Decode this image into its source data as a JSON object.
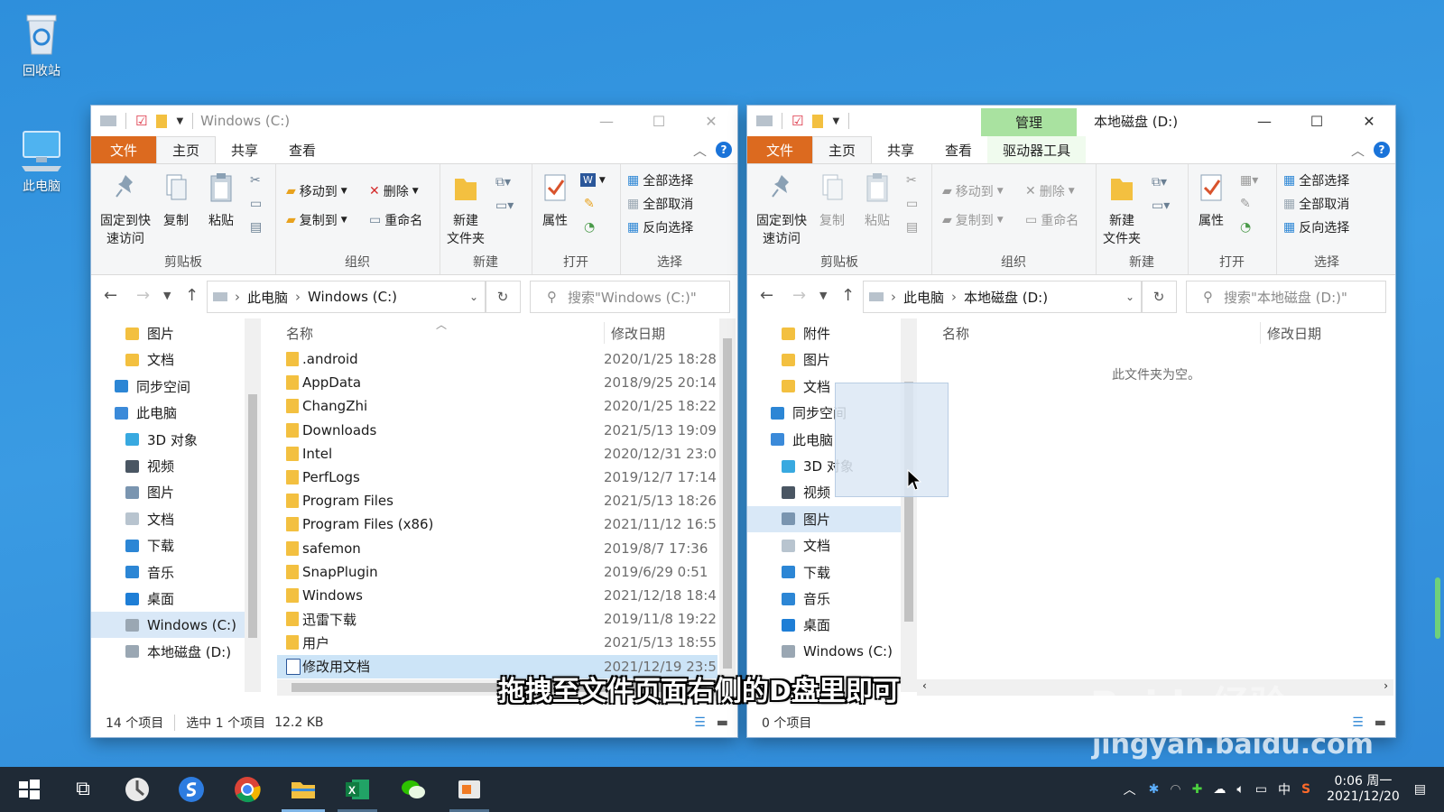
{
  "desktop": {
    "icons": [
      {
        "label": "回收站",
        "icon": "recycle-bin-icon"
      },
      {
        "label": "此电脑",
        "icon": "computer-icon"
      }
    ]
  },
  "left_window": {
    "title": "Windows (C:)",
    "tabs": [
      "文件",
      "主页",
      "共享",
      "查看"
    ],
    "active_tab": "主页",
    "ribbon": {
      "clipboard": {
        "label": "剪贴板",
        "pin": "固定到快\n速访问",
        "copy": "复制",
        "paste": "粘贴"
      },
      "organize": {
        "label": "组织",
        "move_to": "移动到",
        "copy_to": "复制到",
        "delete": "删除",
        "rename": "重命名"
      },
      "new": {
        "label": "新建",
        "new_folder": "新建\n文件夹"
      },
      "open": {
        "label": "打开",
        "properties": "属性"
      },
      "select": {
        "label": "选择",
        "select_all": "全部选择",
        "select_none": "全部取消",
        "invert": "反向选择"
      }
    },
    "address": {
      "crumbs": [
        "此电脑",
        "Windows (C:)"
      ],
      "search_placeholder": "搜索\"Windows (C:)\""
    },
    "nav_items": [
      {
        "label": "图片",
        "icon": "folder-icon",
        "indent": 1
      },
      {
        "label": "文档",
        "icon": "folder-icon",
        "indent": 1
      },
      {
        "label": "同步空间",
        "icon": "sync-space-icon",
        "indent": 0
      },
      {
        "label": "此电脑",
        "icon": "computer-icon",
        "indent": 0
      },
      {
        "label": "3D 对象",
        "icon": "3d-objects-icon",
        "indent": 1
      },
      {
        "label": "视频",
        "icon": "video-icon",
        "indent": 1
      },
      {
        "label": "图片",
        "icon": "pictures-icon",
        "indent": 1
      },
      {
        "label": "文档",
        "icon": "documents-icon",
        "indent": 1
      },
      {
        "label": "下载",
        "icon": "download-icon",
        "indent": 1
      },
      {
        "label": "音乐",
        "icon": "music-icon",
        "indent": 1
      },
      {
        "label": "桌面",
        "icon": "desktop-icon",
        "indent": 1
      },
      {
        "label": "Windows (C:)",
        "icon": "drive-c-icon",
        "indent": 1,
        "selected": true
      },
      {
        "label": "本地磁盘 (D:)",
        "icon": "drive-d-icon",
        "indent": 1
      }
    ],
    "columns": {
      "name": "名称",
      "date": "修改日期"
    },
    "files": [
      {
        "name": ".android",
        "date": "2020/1/25 18:28"
      },
      {
        "name": "AppData",
        "date": "2018/9/25 20:14"
      },
      {
        "name": "ChangZhi",
        "date": "2020/1/25 18:22"
      },
      {
        "name": "Downloads",
        "date": "2021/5/13 19:09"
      },
      {
        "name": "Intel",
        "date": "2020/12/31 23:0"
      },
      {
        "name": "PerfLogs",
        "date": "2019/12/7 17:14"
      },
      {
        "name": "Program Files",
        "date": "2021/5/13 18:26"
      },
      {
        "name": "Program Files (x86)",
        "date": "2021/11/12 16:5"
      },
      {
        "name": "safemon",
        "date": "2019/8/7 17:36"
      },
      {
        "name": "SnapPlugin",
        "date": "2019/6/29 0:51"
      },
      {
        "name": "Windows",
        "date": "2021/12/18 18:4"
      },
      {
        "name": "迅雷下载",
        "date": "2019/11/8 19:22"
      },
      {
        "name": "用户",
        "date": "2021/5/13 18:55"
      },
      {
        "name": "修改用文档",
        "date": "2021/12/19 23:5",
        "selected": true,
        "type": "word"
      }
    ],
    "status": {
      "count": "14 个项目",
      "selection": "选中 1 个项目",
      "size": "12.2 KB"
    }
  },
  "right_window": {
    "title": "本地磁盘 (D:)",
    "context_tab": "管理",
    "tabs": [
      "文件",
      "主页",
      "共享",
      "查看",
      "驱动器工具"
    ],
    "active_tab": "主页",
    "ribbon": {
      "clipboard": {
        "label": "剪贴板",
        "pin": "固定到快\n速访问",
        "copy": "复制",
        "paste": "粘贴"
      },
      "organize": {
        "label": "组织",
        "move_to": "移动到",
        "copy_to": "复制到",
        "delete": "删除",
        "rename": "重命名"
      },
      "new": {
        "label": "新建",
        "new_folder": "新建\n文件夹"
      },
      "open": {
        "label": "打开",
        "properties": "属性"
      },
      "select": {
        "label": "选择",
        "select_all": "全部选择",
        "select_none": "全部取消",
        "invert": "反向选择"
      }
    },
    "address": {
      "crumbs": [
        "此电脑",
        "本地磁盘 (D:)"
      ],
      "search_placeholder": "搜索\"本地磁盘 (D:)\""
    },
    "nav_items": [
      {
        "label": "附件",
        "icon": "folder-icon",
        "indent": 1
      },
      {
        "label": "图片",
        "icon": "folder-icon",
        "indent": 1
      },
      {
        "label": "文档",
        "icon": "folder-icon",
        "indent": 1
      },
      {
        "label": "同步空间",
        "icon": "sync-space-icon",
        "indent": 0
      },
      {
        "label": "此电脑",
        "icon": "computer-icon",
        "indent": 0
      },
      {
        "label": "3D 对象",
        "icon": "3d-objects-icon",
        "indent": 1
      },
      {
        "label": "视频",
        "icon": "video-icon",
        "indent": 1
      },
      {
        "label": "图片",
        "icon": "pictures-icon",
        "indent": 1,
        "selected": true
      },
      {
        "label": "文档",
        "icon": "documents-icon",
        "indent": 1
      },
      {
        "label": "下载",
        "icon": "download-icon",
        "indent": 1
      },
      {
        "label": "音乐",
        "icon": "music-icon",
        "indent": 1
      },
      {
        "label": "桌面",
        "icon": "desktop-icon",
        "indent": 1
      },
      {
        "label": "Windows (C:)",
        "icon": "drive-c-icon",
        "indent": 1
      }
    ],
    "columns": {
      "name": "名称",
      "date": "修改日期"
    },
    "empty_message": "此文件夹为空。",
    "status": {
      "count": "0 个项目"
    }
  },
  "caption": "拖拽至文件页面右侧的D盘里即可",
  "watermark": {
    "brand": "Baidu经验",
    "url": "jingyan.baidu.com"
  },
  "taskbar": {
    "apps": [
      "start-icon",
      "task-view-icon",
      "browser-icon",
      "sogou-icon",
      "chrome-icon",
      "file-explorer-icon",
      "excel-icon",
      "wechat-icon",
      "recorder-icon"
    ],
    "ime": "中",
    "time": "0:06 周一",
    "date": "2021/12/20"
  },
  "colors": {
    "file_tab": "#dc6a1f",
    "context_tab": "#a9e2a0",
    "selection": "#cce4f7",
    "taskbar": "#1f2a36",
    "desktop": "#2f8ddb"
  }
}
